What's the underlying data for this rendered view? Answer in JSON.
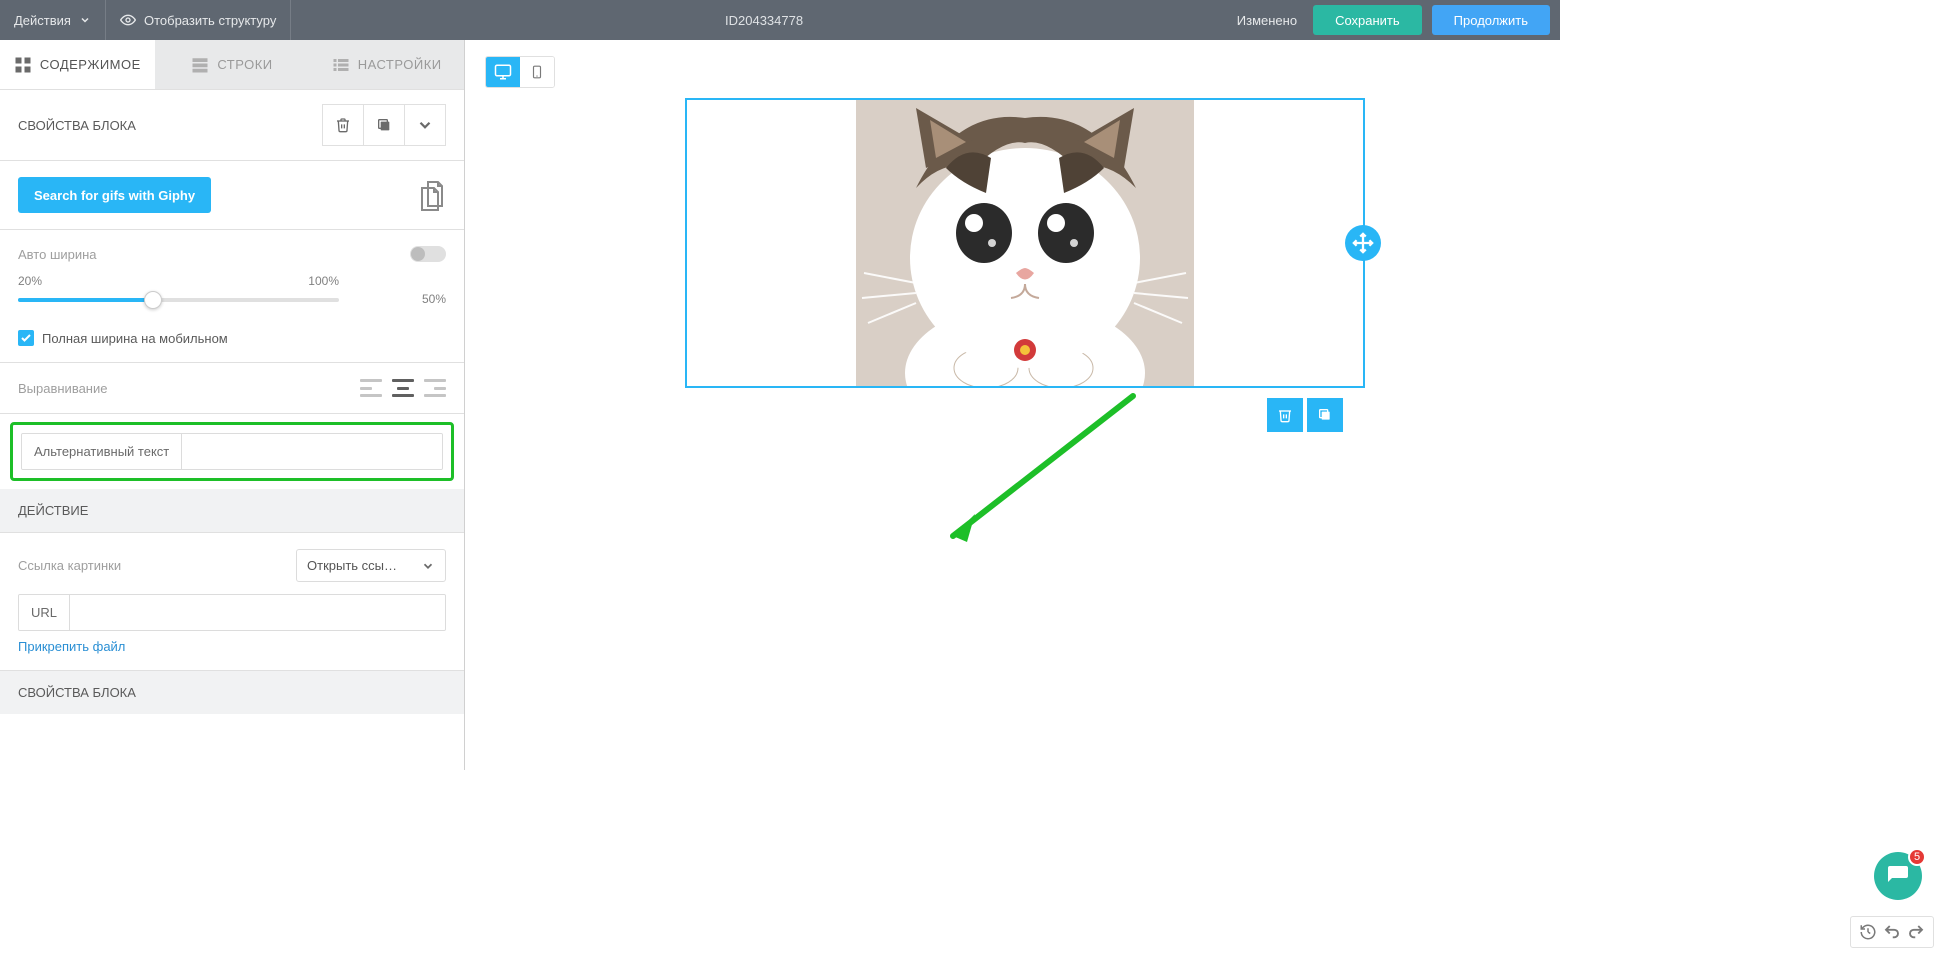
{
  "toolbar": {
    "actions_label": "Действия",
    "show_structure": "Отобразить структуру",
    "id_label": "ID204334778",
    "status": "Изменено",
    "save": "Сохранить",
    "continue": "Продолжить"
  },
  "tabs": {
    "content": "СОДЕРЖИМОЕ",
    "rows": "СТРОКИ",
    "settings": "НАСТРОЙКИ"
  },
  "block_header": "СВОЙСТВА БЛОКА",
  "giphy_btn": "Search for gifs with Giphy",
  "auto_width": "Авто ширина",
  "slider": {
    "min": "20%",
    "max": "100%",
    "value": "50%"
  },
  "full_width_mobile": "Полная ширина на мобильном",
  "alignment_label": "Выравнивание",
  "alt_text_label": "Альтернативный текст",
  "alt_text_value": "",
  "action_header": "ДЕЙСТВИЕ",
  "link_image": "Ссылка картинки",
  "open_link_select": "Открыть ссы…",
  "url_label": "URL",
  "url_value": "",
  "attach_file": "Прикрепить файл",
  "block_footer": "СВОЙСТВА БЛОКА",
  "chat_badge": "5"
}
